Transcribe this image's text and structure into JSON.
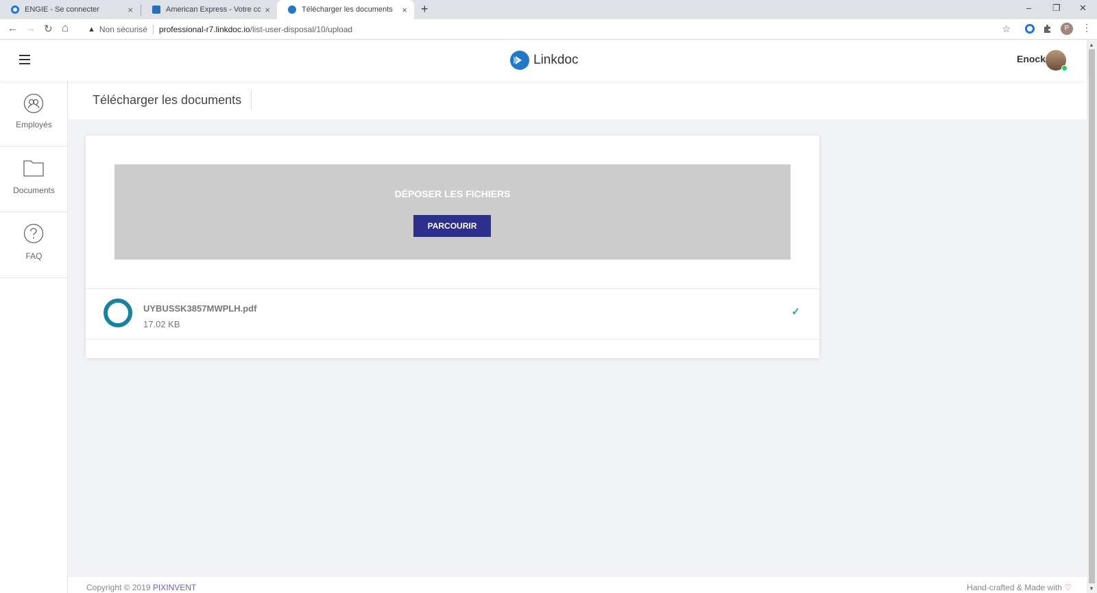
{
  "browser": {
    "tabs": [
      {
        "title": "ENGIE - Se connecter",
        "close": "×"
      },
      {
        "title": "American Express - Votre compte",
        "close": "×"
      },
      {
        "title": "Télécharger les documents",
        "close": "×"
      }
    ],
    "new_tab": "+",
    "window_controls": {
      "minimize": "–",
      "restore": "❐",
      "close": "✕"
    },
    "nav": {
      "back": "←",
      "forward": "→",
      "reload": "↻",
      "home": "⌂"
    },
    "security_label": "Non sécurisé",
    "url_host": "professional-r7.linkdoc.io",
    "url_path": "/list-user-disposal/10/upload",
    "bookmark_icon": "star-icon",
    "profile_initial": "P"
  },
  "header": {
    "app_name": "Linkdoc",
    "user_name": "Enock"
  },
  "sidebar": {
    "items": [
      {
        "label": "Employés",
        "icon": "employees-icon"
      },
      {
        "label": "Documents",
        "icon": "folder-icon"
      },
      {
        "label": "FAQ",
        "icon": "help-icon"
      }
    ]
  },
  "page": {
    "title": "Télécharger les documents"
  },
  "upload": {
    "drop_label": "DÉPOSER LES FICHIERS",
    "browse_label": "PARCOURIR",
    "files": [
      {
        "name": "UYBUSSK3857MWPLH.pdf",
        "size": "17.02 KB",
        "status": "✓"
      }
    ]
  },
  "footer": {
    "copyright": "Copyright © 2019 ",
    "brand": "PIXINVENT",
    "made_with": "Hand-crafted & Made with ",
    "heart": "♡"
  },
  "colors": {
    "primary_button": "#2c2f8c",
    "file_ring": "#1484a0",
    "success": "#22b07d",
    "dropzone": "#cccccc"
  }
}
